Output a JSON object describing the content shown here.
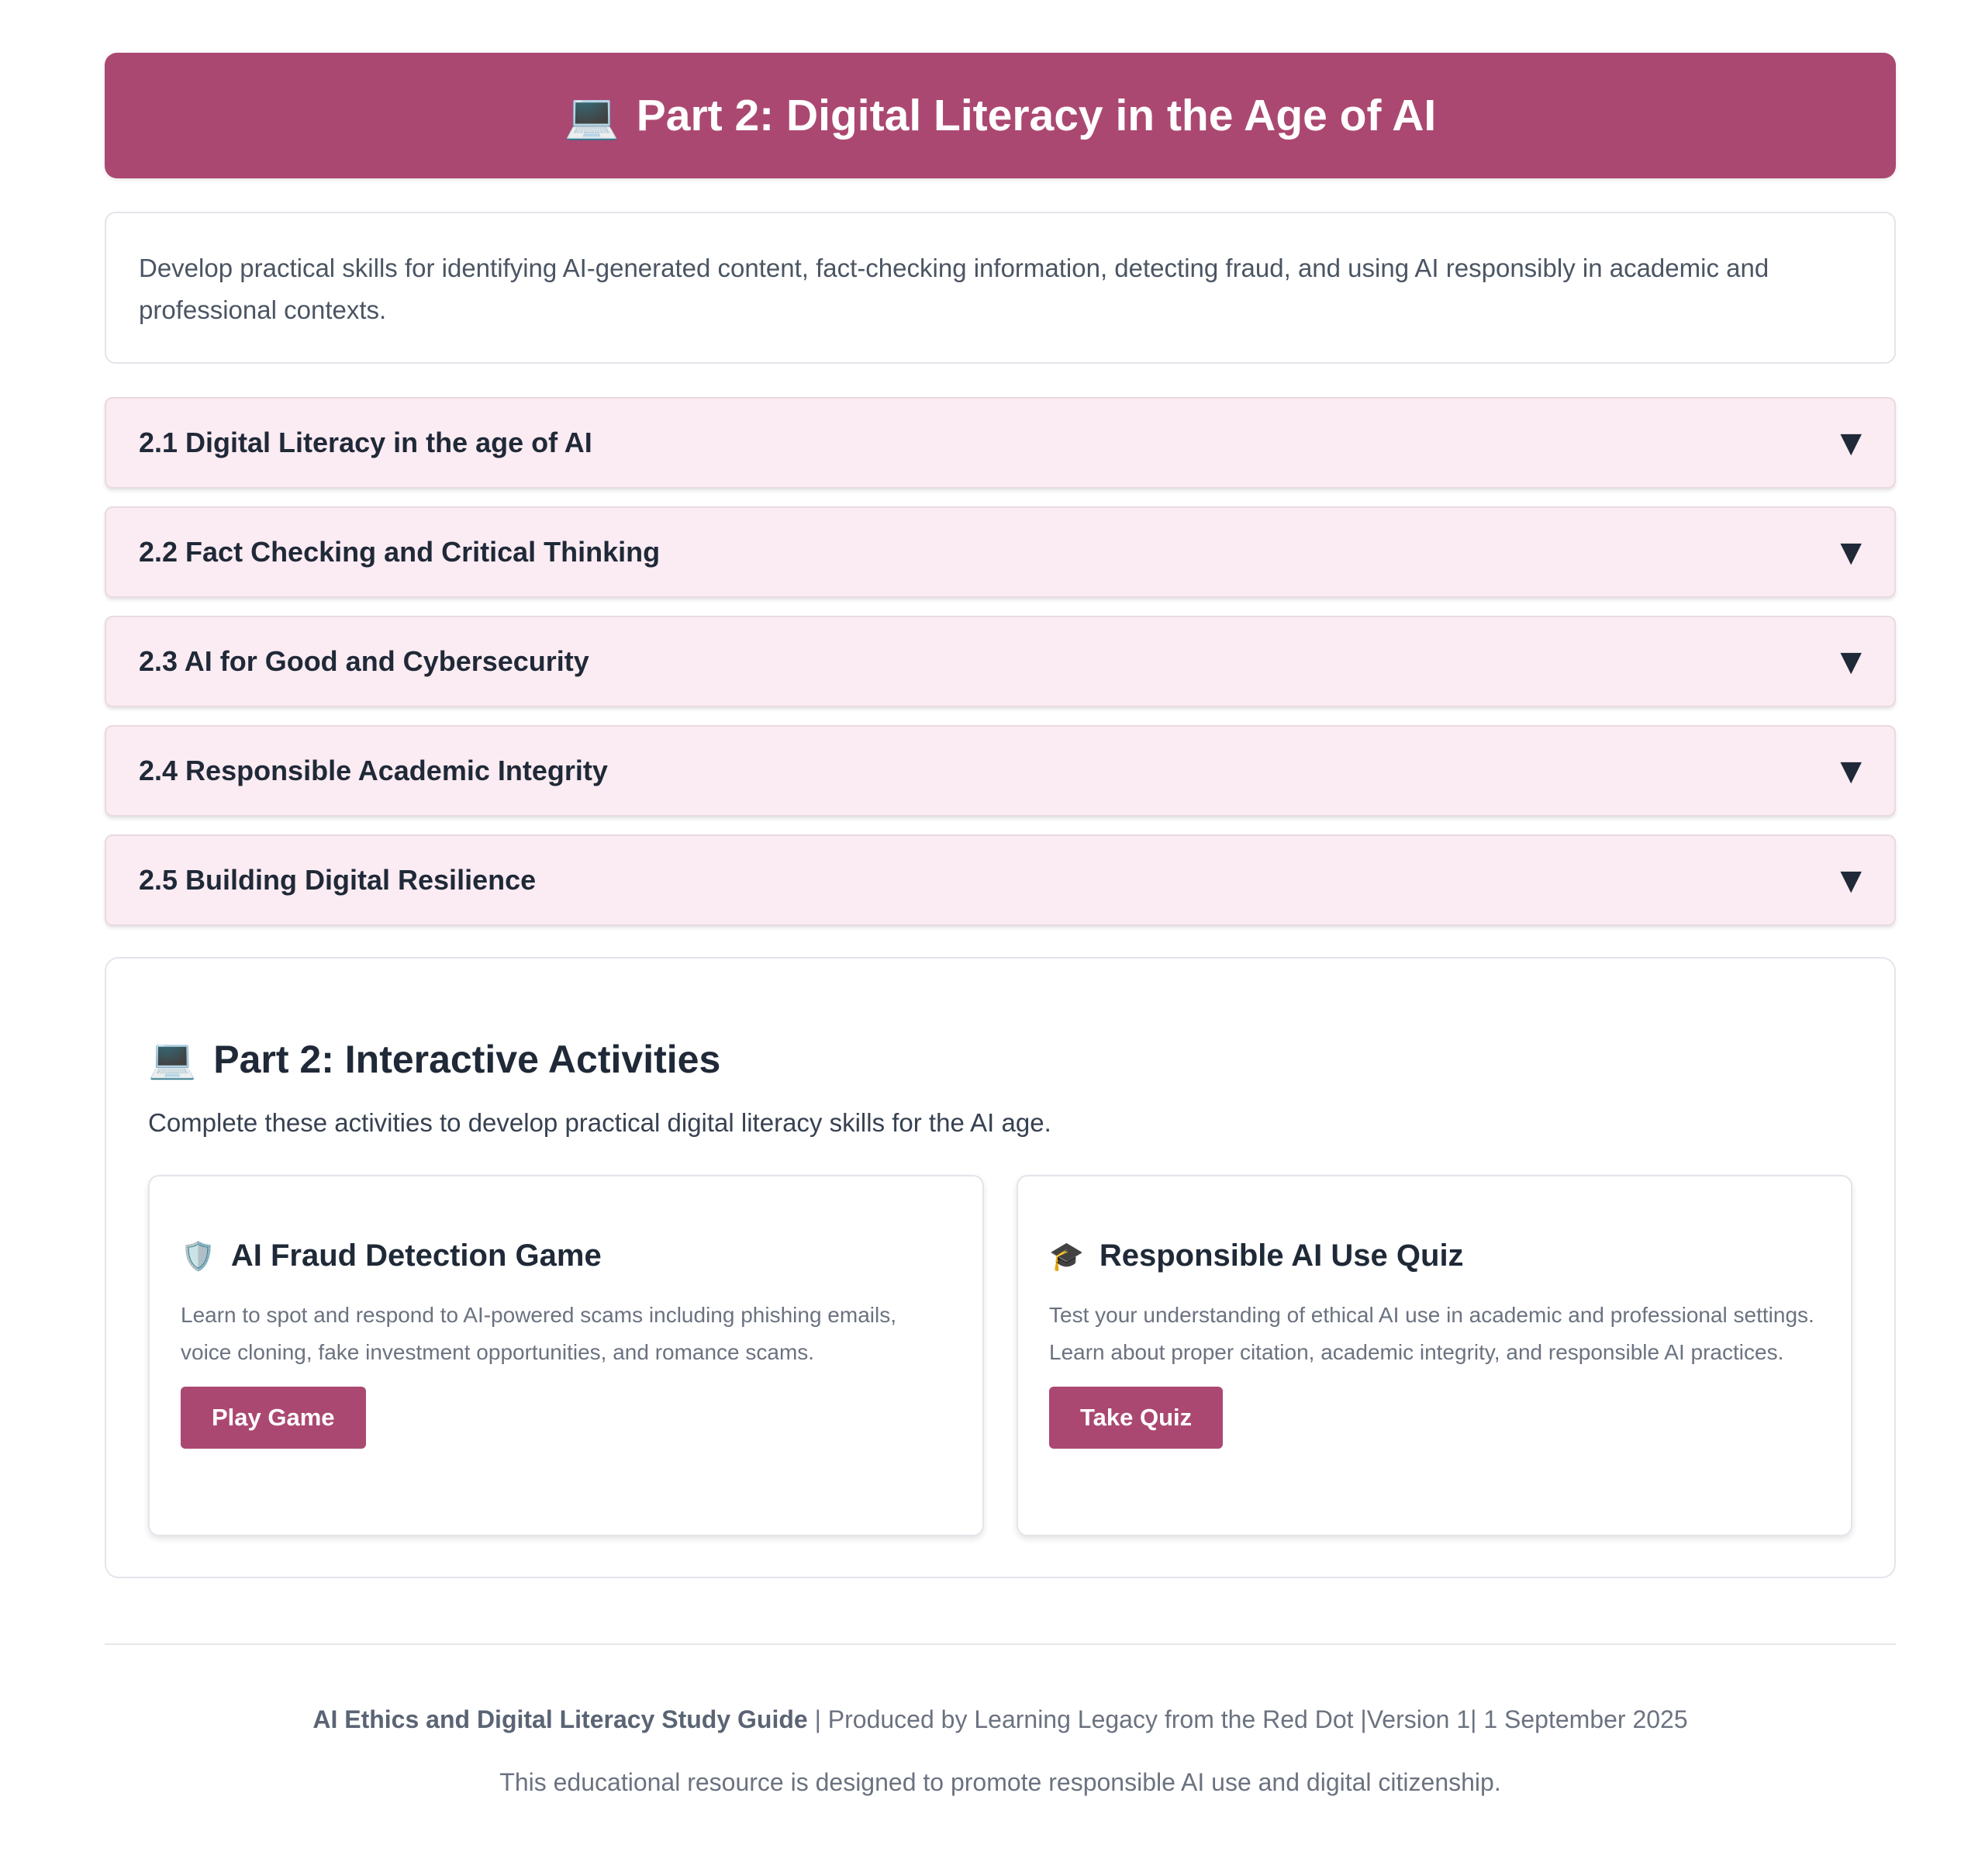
{
  "hero": {
    "icon": "laptop-icon",
    "emoji": "💻",
    "title": "Part 2: Digital Literacy in the Age of AI"
  },
  "intro": {
    "text": "Develop practical skills for identifying AI-generated content, fact-checking information, detecting fraud, and using AI responsibly in academic and professional contexts."
  },
  "accordion": [
    {
      "label": "2.1 Digital Literacy in the age of AI",
      "arrow": "▼"
    },
    {
      "label": "2.2 Fact Checking and Critical Thinking",
      "arrow": "▼"
    },
    {
      "label": "2.3 AI for Good and Cybersecurity",
      "arrow": "▼"
    },
    {
      "label": "2.4 Responsible Academic Integrity",
      "arrow": "▼"
    },
    {
      "label": "2.5 Building Digital Resilience",
      "arrow": "▼"
    }
  ],
  "activities": {
    "icon": "laptop-icon",
    "emoji": "💻",
    "title": "Part 2: Interactive Activities",
    "subtitle": "Complete these activities to develop practical digital literacy skills for the AI age.",
    "cards": [
      {
        "icon": "shield-icon",
        "emoji": "🛡️",
        "title": "AI Fraud Detection Game",
        "description": "Learn to spot and respond to AI-powered scams including phishing emails, voice cloning, fake investment opportunities, and romance scams.",
        "button": "Play Game"
      },
      {
        "icon": "graduation-cap-icon",
        "emoji": "🎓",
        "title": "Responsible AI Use Quiz",
        "description": "Test your understanding of ethical AI use in academic and professional settings. Learn about proper citation, academic integrity, and responsible AI practices.",
        "button": "Take Quiz"
      }
    ]
  },
  "footer": {
    "guide": "AI Ethics and Digital Literacy Study Guide",
    "rest": " | Produced by Learning Legacy from the Red Dot |Version 1| 1 September 2025",
    "line2": "This educational resource is designed to promote responsible AI use and digital citizenship."
  },
  "colors": {
    "accent": "#ab4871",
    "accordion_bg": "#fbebf2"
  }
}
